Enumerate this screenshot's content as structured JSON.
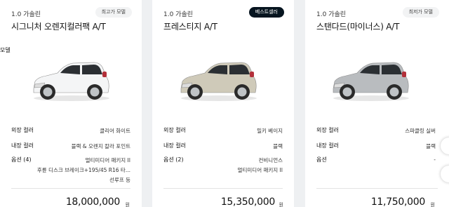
{
  "cards": [
    {
      "engine": "1.0 가솔린",
      "name": "시그니처 오렌지컬러팩 A/T",
      "badge": "최고가 모델",
      "side_label": "모델",
      "car_color": "#f4f5f6",
      "exterior_label": "외장 컬러",
      "exterior_value": "클리어 화이트",
      "interior_label": "내장 컬러",
      "interior_value": "블랙 & 오렌지 칼라 포인트",
      "options_label": "옵션 (4)",
      "options_values": [
        "멀티미디어 패키지 II",
        "후륜 디스크 브레이크+195/45 R16 타...",
        "선루프 등"
      ],
      "price": "18,000,000",
      "currency": "원"
    },
    {
      "engine": "1.0 가솔린",
      "name": "프레스티지 A/T",
      "badge": "베스트셀러",
      "car_color": "#cfcab9",
      "exterior_label": "외장 컬러",
      "exterior_value": "밀키 베이지",
      "interior_label": "내장 컬러",
      "interior_value": "블랙",
      "options_label": "옵션 (2)",
      "options_values": [
        "컨비니언스",
        "멀티미디어 패키지 II"
      ],
      "price": "15,350,000",
      "currency": "원"
    },
    {
      "engine": "1.0 가솔린",
      "name": "스탠다드(마이너스) A/T",
      "badge": "최저가 모델",
      "car_color": "#b9bcbf",
      "exterior_label": "외장 컬러",
      "exterior_value": "스파클링 실버",
      "interior_label": "내장 컬러",
      "interior_value": "블랙",
      "options_label": "옵션",
      "options_values": [
        "-"
      ],
      "price": "11,750,000",
      "currency": "원"
    }
  ]
}
